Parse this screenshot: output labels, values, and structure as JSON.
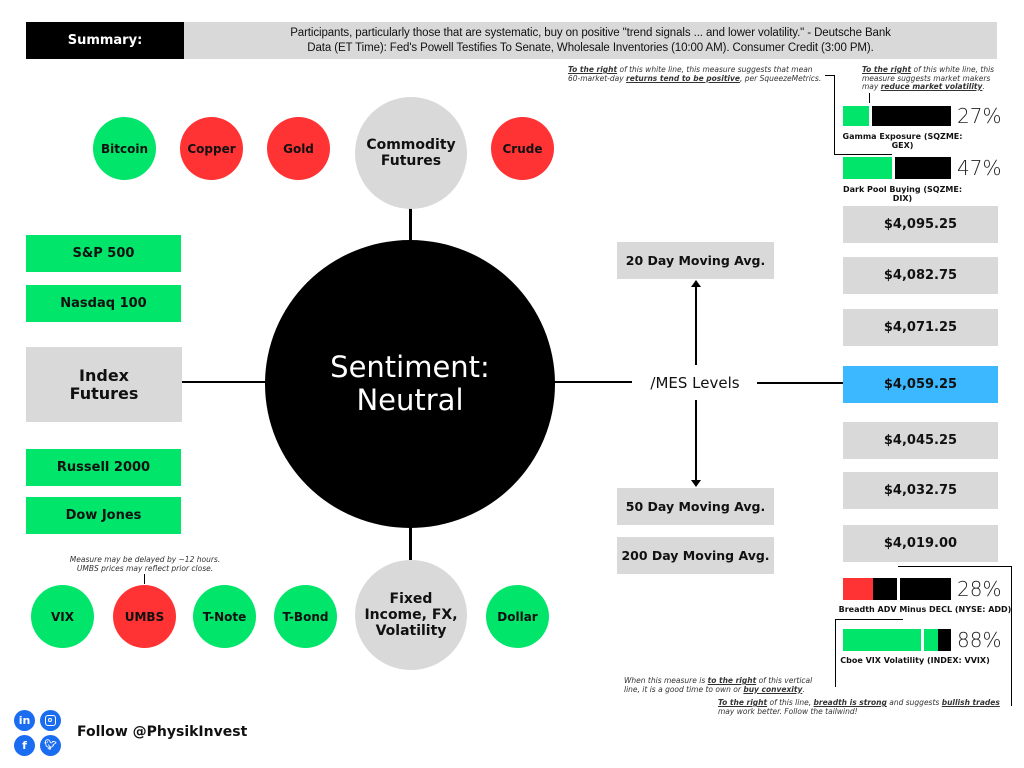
{
  "header": {
    "summary_label": "Summary:",
    "summary_line1": "Participants, particularly those that are systematic, buy on positive \"trend signals ... and lower volatility.\" - Deutsche Bank",
    "summary_line2": "Data (ET Time): Fed's Powell Testifies To Senate, Wholesale Inventories (10:00 AM). Consumer Credit (3:00 PM)."
  },
  "colors": {
    "positive": "#00e56a",
    "negative": "#ff3333",
    "neutral": "#d9d9d9",
    "current_level": "#3bb8ff",
    "social": "#1a6cf0"
  },
  "center": {
    "title_line1": "Sentiment:",
    "title_line2": "Neutral"
  },
  "commodities": {
    "hub_line1": "Commodity",
    "hub_line2": "Futures",
    "items": [
      {
        "label": "Bitcoin",
        "status": "positive"
      },
      {
        "label": "Copper",
        "status": "negative"
      },
      {
        "label": "Gold",
        "status": "negative"
      },
      {
        "label": "Crude",
        "status": "negative"
      }
    ]
  },
  "index_futures": {
    "hub_line1": "Index",
    "hub_line2": "Futures",
    "items": [
      {
        "label": "S&P 500",
        "status": "positive"
      },
      {
        "label": "Nasdaq 100",
        "status": "positive"
      },
      {
        "label": "Russell 2000",
        "status": "positive"
      },
      {
        "label": "Dow Jones",
        "status": "positive"
      }
    ]
  },
  "fixed_income": {
    "hub_line1": "Fixed",
    "hub_line2": "Income, FX,",
    "hub_line3": "Volatility",
    "note_line1": "Measure may be delayed by ~12 hours.",
    "note_line2": "UMBS prices may reflect prior close.",
    "items": [
      {
        "label": "VIX",
        "status": "positive"
      },
      {
        "label": "UMBS",
        "status": "negative"
      },
      {
        "label": "T-Note",
        "status": "positive"
      },
      {
        "label": "T-Bond",
        "status": "positive"
      },
      {
        "label": "Dollar",
        "status": "positive"
      }
    ]
  },
  "mes": {
    "label": "/MES Levels",
    "moving_averages": {
      "ma20": "20 Day Moving Avg.",
      "ma50": "50 Day Moving Avg.",
      "ma200": "200 Day Moving Avg."
    },
    "levels": [
      {
        "value": "$4,095.25",
        "current": false
      },
      {
        "value": "$4,082.75",
        "current": false
      },
      {
        "value": "$4,071.25",
        "current": false
      },
      {
        "value": "$4,059.25",
        "current": true
      },
      {
        "value": "$4,045.25",
        "current": false
      },
      {
        "value": "$4,032.75",
        "current": false
      },
      {
        "value": "$4,019.00",
        "current": false
      }
    ]
  },
  "gauges": {
    "gex": {
      "label": "Gamma Exposure (SQZME: GEX)",
      "percent_text": "27%",
      "percent": 27
    },
    "dix": {
      "label": "Dark Pool Buying (SQZME: DIX)",
      "percent_text": "47%",
      "percent": 47
    },
    "add": {
      "label": "Breadth ADV Minus DECL (NYSE: ADD)",
      "percent_text": "28%",
      "percent": 28
    },
    "vvix": {
      "label": "Cboe VIX Volatility (INDEX: VVIX)",
      "percent_text": "88%",
      "percent": 88
    }
  },
  "notes": {
    "dix_note_line1": "of this white line, this measure suggests that mean",
    "dix_note_line2": "60-market-day",
    "dix_note_emph": "returns tend to be positive",
    "dix_note_tail": ", per SqueezeMetrics.",
    "gex_note_line1": "of this white line, this",
    "gex_note_line2": "measure suggests market makers",
    "gex_note_line3": "may",
    "gex_note_emph": "reduce market volatility",
    "to_the_right": "To the right",
    "vvix_note_a": "When this measure is",
    "vvix_note_emph1": "to the right",
    "vvix_note_b": "of this vertical",
    "vvix_note_c": "line, it is a good time to own or",
    "vvix_note_emph2": "buy convexity",
    "add_note_a": "of this line,",
    "add_note_emph1": "breadth is strong",
    "add_note_b": "and suggests",
    "add_note_emph2": "bullish trades",
    "add_note_c": "may work better. Follow the tailwind!"
  },
  "footer": {
    "follow_text": "Follow @PhysikInvest",
    "socials": [
      "linkedin-icon",
      "instagram-icon",
      "facebook-icon",
      "twitter-icon"
    ]
  }
}
